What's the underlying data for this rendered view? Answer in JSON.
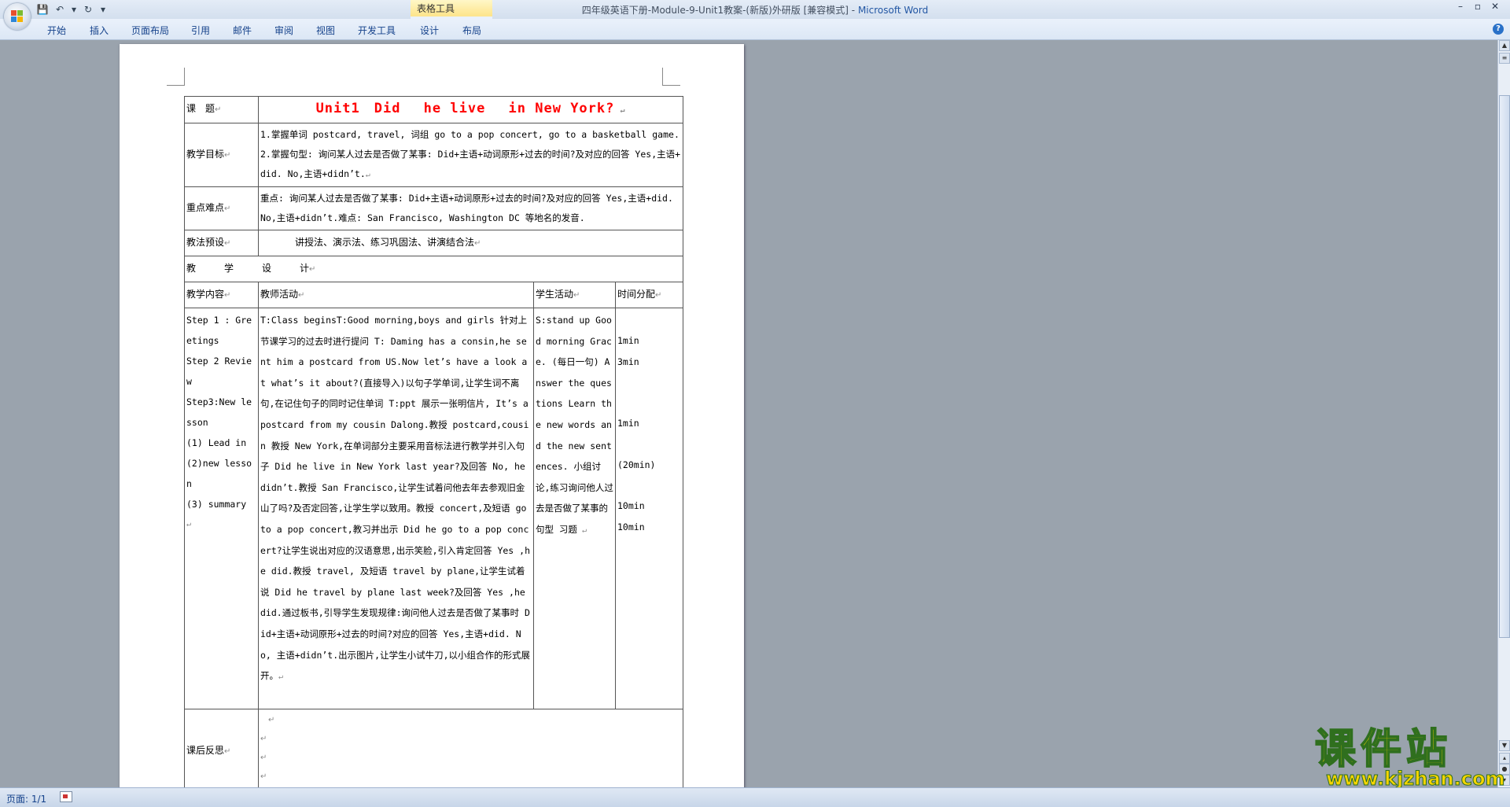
{
  "window": {
    "title_doc": "四年级英语下册-Module-9-Unit1教案-(新版)外研版 [兼容模式] - ",
    "title_app": "Microsoft Word",
    "minimize": "–",
    "restore": "▫",
    "close": "✕"
  },
  "qat": {
    "save": "💾",
    "undo": "↶",
    "undo_arrow": "▾",
    "redo": "↻",
    "customize": "▾"
  },
  "ribbon": {
    "context_group": "表格工具",
    "tabs": [
      "开始",
      "插入",
      "页面布局",
      "引用",
      "邮件",
      "审阅",
      "视图",
      "开发工具",
      "设计",
      "布局"
    ],
    "help": "?"
  },
  "doc": {
    "rows": {
      "topic_label": "课　题",
      "topic_value": "Unit1　Did　 he live 　in New York?",
      "goals_label": "教学目标",
      "goals_line1": "1.掌握单词 postcard, travel, 词组 go to a pop concert, go to a basketball game.",
      "goals_line2": "2.掌握句型: 询问某人过去是否做了某事: Did+主语+动词原形+过去的时间?及对应的回答 Yes,主语+did. No,主语+didn’t.",
      "key_label": "重点难点",
      "key_value": "重点: 询问某人过去是否做了某事: Did+主语+动词原形+过去的时间?及对应的回答 Yes,主语+did. No,主语+didn’t.难点: San Francisco, Washington DC 等地名的发音.",
      "method_label": "教法预设",
      "method_value": "讲授法、演示法、练习巩固法、讲演结合法",
      "design_label": "教　　　学　　　设　　　计",
      "col_content": "教学内容",
      "col_teacher": "教师活动",
      "col_student": "学生活动",
      "col_time": "时间分配",
      "content_steps": [
        "Step 1 : Greetings",
        "Step 2 Review",
        "Step3:New lesson",
        "(1) Lead in",
        "(2)new lesson",
        "(3) summary"
      ],
      "teacher_text": "T:Class beginsT:Good morning,boys and girls 针对上节课学习的过去时进行提问 T: Daming has a consin,he sent him a postcard from US.Now let’s have a look at what’s it about?(直接导入)以句子学单词,让学生词不离句,在记住句子的同时记住单词 T:ppt 展示一张明信片, It’s a postcard from my cousin Dalong.教授 postcard,cousin 教授 New York,在单词部分主要采用音标法进行教学并引入句子 Did he live in New York last year?及回答 No, he didn’t.教授 San Francisco,让学生试着问他去年去参观旧金山了吗?及否定回答,让学生学以致用。教授 concert,及短语 go to a pop concert,教习并出示 Did he go to a pop concert?让学生说出对应的汉语意思,出示笑脸,引入肯定回答 Yes ,he did.教授 travel, 及短语 travel by plane,让学生试着说 Did he travel by plane last week?及回答 Yes ,he did.通过板书,引导学生发现规律:询问他人过去是否做了某事时 Did+主语+动词原形+过去的时间?对应的回答 Yes,主语+did. No, 主语+didn’t.出示图片,让学生小试牛刀,以小组合作的形式展开。",
      "student_text": "S:stand up Good morning Grace. (每日一句) Answer the questions Learn the new words and the new sentences. 小组讨论,练习询问他人过去是否做了某事的句型 习题",
      "time_items": [
        "",
        "1min",
        "3min",
        "",
        "",
        "1min",
        "",
        "(20min)",
        "",
        "10min",
        "10min",
        ""
      ],
      "reflection_label": "课后反思"
    }
  },
  "status": {
    "page": "页面: 1/1"
  },
  "watermark": {
    "cn": "课件站",
    "url": "www.kjzhan.com"
  }
}
